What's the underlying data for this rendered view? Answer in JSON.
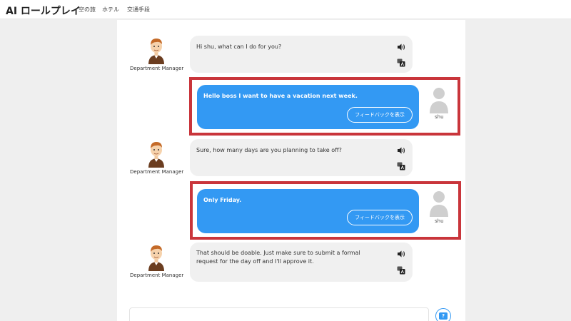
{
  "header": {
    "app_title": "AI ロールプレイ",
    "nav": [
      {
        "label": "空の旅"
      },
      {
        "label": "ホテル"
      },
      {
        "label": "交通手段"
      }
    ]
  },
  "messages": [
    {
      "role": "assistant",
      "speaker": "Department Manager",
      "lines": [
        "Hi shu, what can I do for you?"
      ]
    },
    {
      "role": "user",
      "speaker": "shu",
      "lines": [
        "Hello boss I want to have a vacation next week."
      ],
      "feedback_label": "フィードバックを表示"
    },
    {
      "role": "assistant",
      "speaker": "Department Manager",
      "lines": [
        "Sure, how many days are you planning to take off?"
      ]
    },
    {
      "role": "user",
      "speaker": "shu",
      "lines": [
        "Only Friday."
      ],
      "feedback_label": "フィードバックを表示"
    },
    {
      "role": "assistant",
      "speaker": "Department Manager",
      "lines": [
        "That should be doable. Just make sure to submit a formal",
        "request for the day off and I'll approve it."
      ]
    }
  ],
  "icons": {
    "speaker": "speaker-icon",
    "translate": "translate-icon",
    "help": "help-icon"
  },
  "colors": {
    "user_bubble": "#3399f3",
    "highlight_border": "#c9353b",
    "assistant_bubble": "#f0f0f0"
  }
}
